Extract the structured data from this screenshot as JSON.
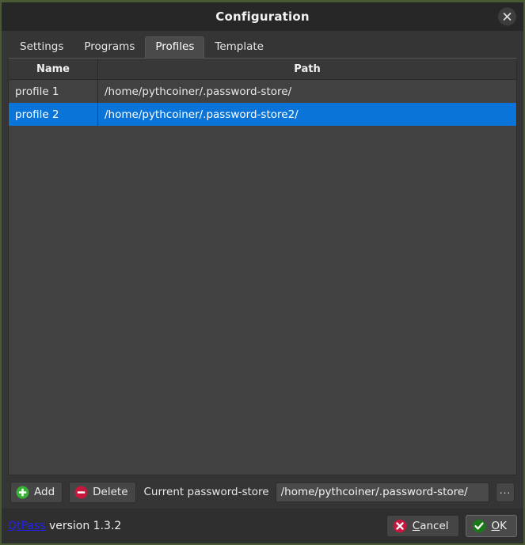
{
  "window": {
    "title": "Configuration",
    "close_icon": "close-icon",
    "border_color": "#4a5a35",
    "titlebar_bg": "#272727"
  },
  "tabs": [
    {
      "label": "Settings",
      "selected": false
    },
    {
      "label": "Programs",
      "selected": false
    },
    {
      "label": "Profiles",
      "selected": true
    },
    {
      "label": "Template",
      "selected": false
    }
  ],
  "table": {
    "columns": [
      "Name",
      "Path"
    ],
    "selection_color": "#0a74d8",
    "rows": [
      {
        "name": "profile 1",
        "path": "/home/pythcoiner/.password-store/",
        "selected": false
      },
      {
        "name": "profile 2",
        "path": "/home/pythcoiner/.password-store2/",
        "selected": true
      }
    ]
  },
  "bottom_bar": {
    "add_label": "Add",
    "add_icon": "plus-circle-icon",
    "add_icon_color": "#35b234",
    "delete_label": "Delete",
    "delete_icon": "minus-circle-icon",
    "delete_icon_color": "#c9163d",
    "current_store_label": "Current password-store",
    "current_store_value": "/home/pythcoiner/.password-store/",
    "current_store_placeholder": "",
    "browse_label": "...",
    "browse_icon": "ellipsis-icon"
  },
  "footer": {
    "link_text": "QtPass",
    "link_color": "#2222ee",
    "version_text": " version 1.3.2",
    "cancel": {
      "accel": "C",
      "rest": "ancel",
      "icon": "cross-circle-icon",
      "icon_color": "#c9163d"
    },
    "ok": {
      "accel": "O",
      "rest": "K",
      "icon": "check-circle-icon",
      "icon_color": "#1a7a1a"
    }
  }
}
